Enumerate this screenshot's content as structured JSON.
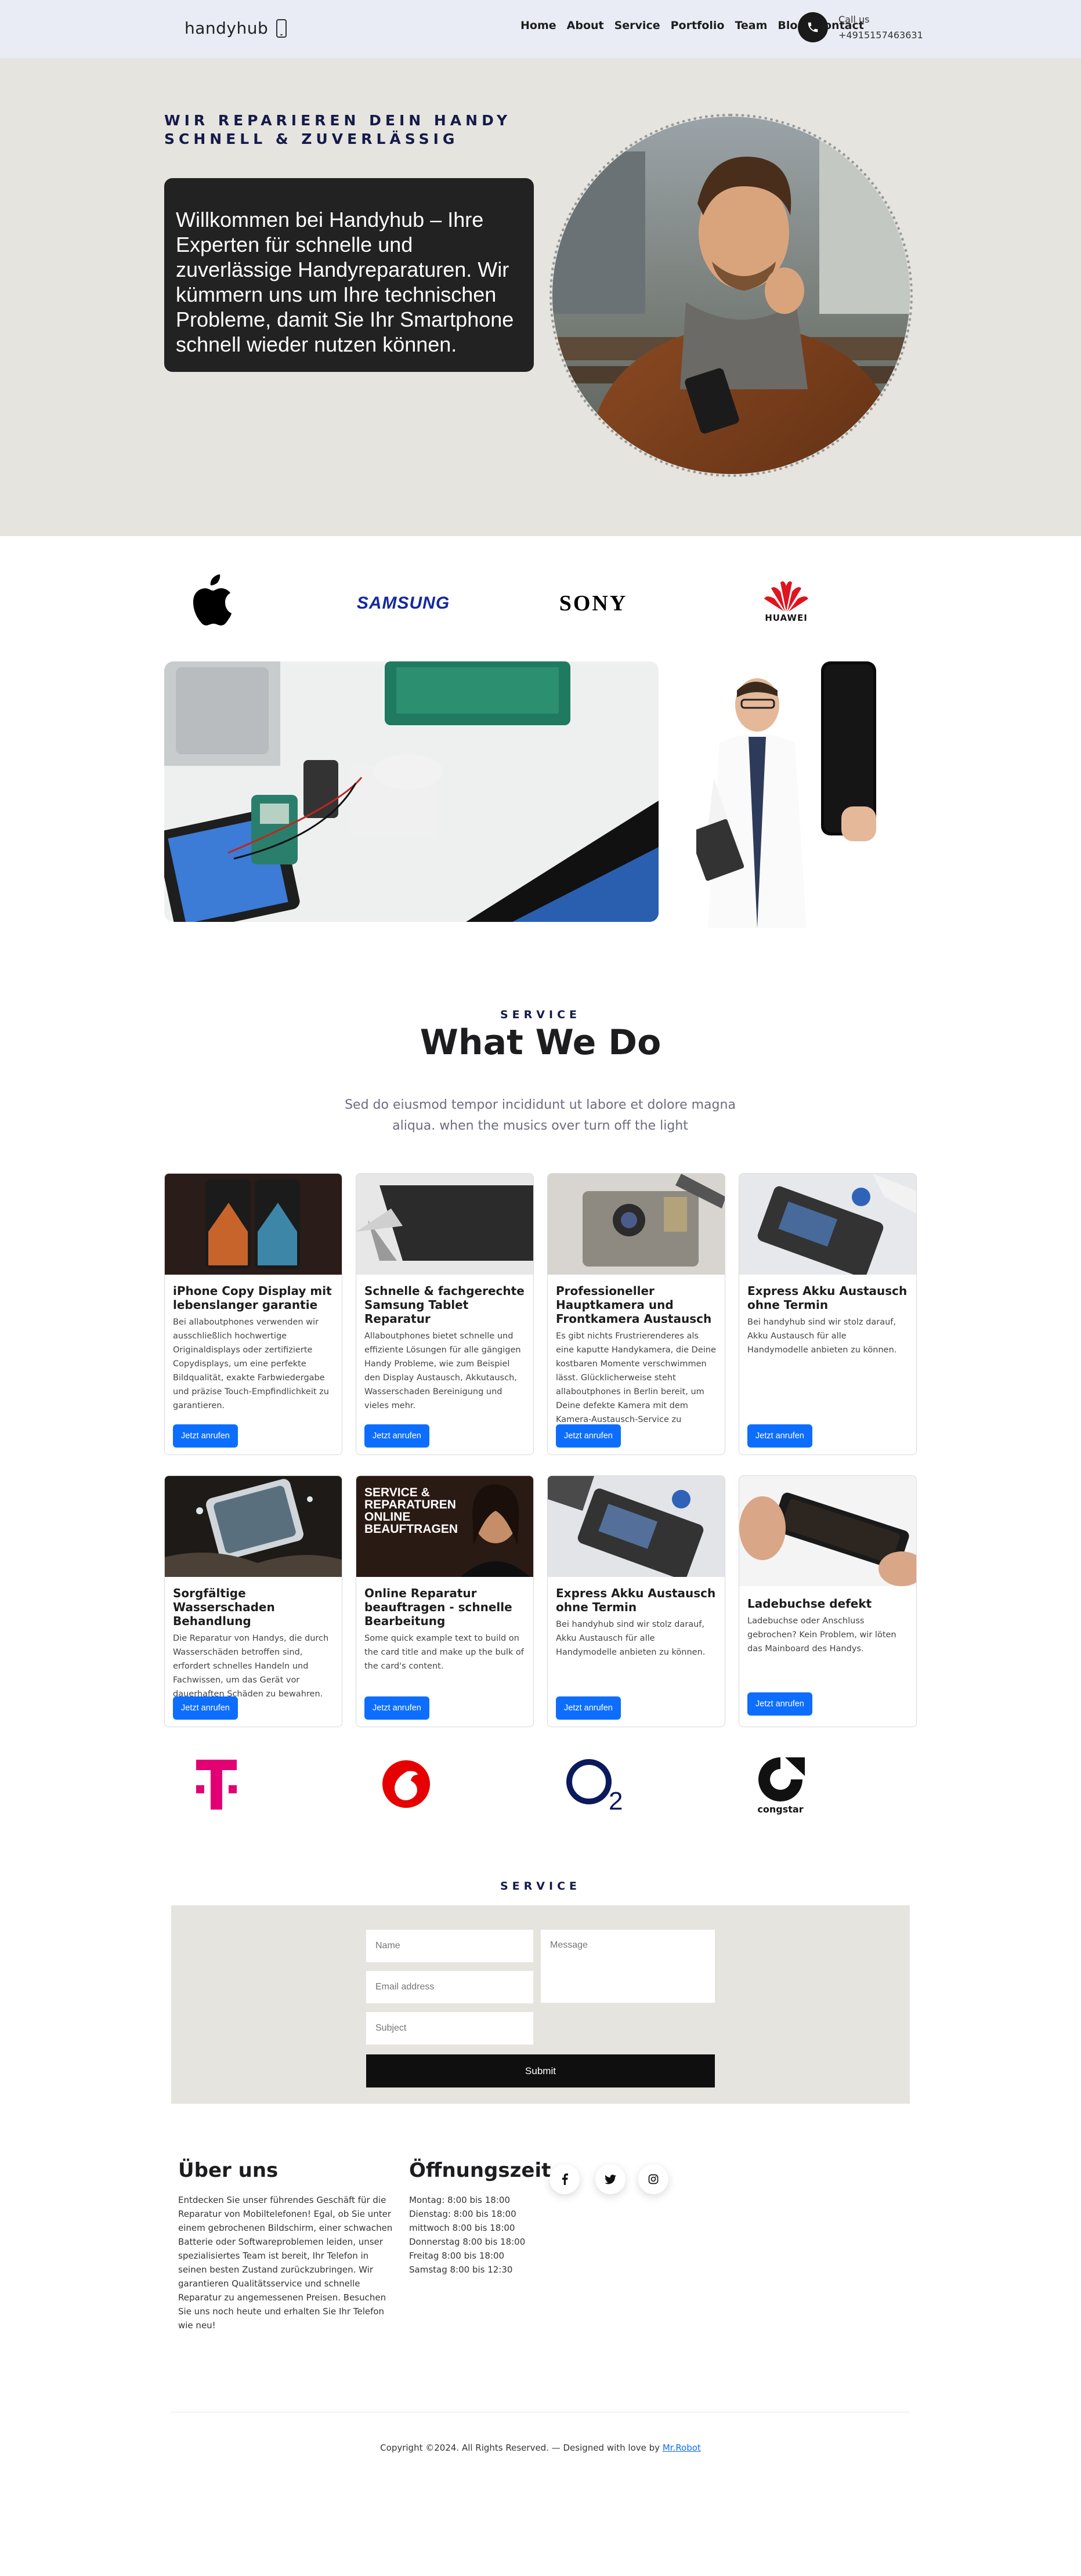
{
  "header": {
    "logo_text": "handyhub",
    "logo_icon": "phone-icon",
    "nav": [
      "Home",
      "About",
      "Service",
      "Portfolio",
      "Team",
      "Blog",
      "Contact"
    ],
    "call_label": "Call us",
    "call_number": "+4915157463631",
    "call_icon": "phone-call-icon"
  },
  "hero": {
    "tagline": "WIR REPARIEREN DEIN HANDY SCHNELL & ZUVERLÄSSIG",
    "intro": "Willkommen bei Handyhub – Ihre Experten für schnelle und zuverlässige Handyreparaturen. Wir kümmern uns um Ihre technischen Probleme, damit Sie Ihr Smartphone schnell wieder nutzen können."
  },
  "brands": {
    "apple_icon": "apple-logo",
    "samsung": "SAMSUNG",
    "sony": "SONY",
    "huawei": "HUAWEI"
  },
  "services": {
    "tag": "SERVICE",
    "title": "What We Do",
    "description": "Sed do eiusmod tempor incididunt ut labore et dolore magna aliqua. when the musics over turn off the light",
    "button_label": "Jetzt anrufen",
    "cards": [
      {
        "title": "iPhone Copy Display mit lebenslanger garantie",
        "text": "Bei allaboutphones verwenden wir ausschließlich hochwertige Originaldisplays oder zertifizierte Copydisplays, um eine perfekte Bildqualität, exakte Farbwiedergabe und präzise Touch-Empfindlichkeit zu garantieren."
      },
      {
        "title": "Schnelle & fachgerechte Samsung Tablet Reparatur",
        "text": "Allaboutphones bietet schnelle und effiziente Lösungen für alle gängigen Handy Probleme, wie zum Beispiel den Display Austausch, Akkutausch, Wasserschaden Bereinigung und vieles mehr."
      },
      {
        "title": "Professioneller Hauptkamera und Frontkamera Austausch",
        "text": "Es gibt nichts Frustrierenderes als eine kaputte Handykamera, die Deine kostbaren Momente verschwimmen lässt. Glücklicherweise steht allaboutphones in Berlin bereit, um Deine defekte Kamera mit dem Kamera-Austausch-Service zu reparieren."
      },
      {
        "title": "Express Akku Austausch ohne Termin",
        "text": "Bei handyhub sind wir stolz darauf, Akku Austausch für alle Handymodelle anbieten zu können."
      },
      {
        "title": "Sorgfältige Wasserschaden Behandlung",
        "text": "Die Reparatur von Handys, die durch Wasserschäden betroffen sind, erfordert schnelles Handeln und Fachwissen, um das Gerät vor dauerhaften Schäden zu bewahren."
      },
      {
        "title": "Online Reparatur beauftragen - schnelle Bearbeitung",
        "text": "Some quick example text to build on the card title and make up the bulk of the card's content.",
        "image_text": "SERVICE & REPARATUREN ONLINE BEAUFTRAGEN"
      },
      {
        "title": "Express Akku Austausch ohne Termin",
        "text": "Bei handyhub sind wir stolz darauf, Akku Austausch für alle Handymodelle anbieten zu können."
      },
      {
        "title": "Ladebuchse defekt",
        "text": "Ladebuchse oder Anschluss gebrochen? Kein Problem, wir löten das Mainboard des Handys."
      }
    ]
  },
  "carriers": {
    "telekom": "T",
    "o2": "O2",
    "congstar": "congstar"
  },
  "contact": {
    "tag": "SERVICE",
    "name_placeholder": "Name",
    "email_placeholder": "Email address",
    "subject_placeholder": "Subject",
    "message_placeholder": "Message",
    "submit_label": "Submit"
  },
  "footer": {
    "about_title": "Über uns",
    "about_text": "Entdecken Sie unser führendes Geschäft für die Reparatur von Mobiltelefonen! Egal, ob Sie unter einem gebrochenen Bildschirm, einer schwachen Batterie oder Softwareproblemen leiden, unser spezialisiertes Team ist bereit, Ihr Telefon in seinen besten Zustand zurückzubringen. Wir garantieren Qualitätsservice und schnelle Reparatur zu angemessenen Preisen. Besuchen Sie uns noch heute und erhalten Sie Ihr Telefon wie neu!",
    "hours_title": "Öffnungszeit",
    "hours": [
      "Montag: 8:00 bis 18:00",
      "Dienstag: 8:00 bis 18:00",
      "mittwoch 8:00 bis 18:00",
      "Donnerstag 8:00 bis 18:00",
      "Freitag 8:00 bis 18:00",
      "Samstag 8:00 bis 12:30"
    ],
    "social_icons": [
      "facebook-icon",
      "twitter-icon",
      "instagram-icon"
    ],
    "copyright": "Copyright ©2024. All Rights Reserved. — Designed with love by",
    "credit": "Mr.Robot"
  },
  "colors": {
    "header_bg": "#e9ecf4",
    "hero_bg": "#e6e4de",
    "dark_box": "#222222",
    "tag_navy": "#141a4a",
    "button_blue": "#0d6efd",
    "telekom": "#e20074",
    "vodafone": "#e60000",
    "o2": "#0a1a5c"
  }
}
